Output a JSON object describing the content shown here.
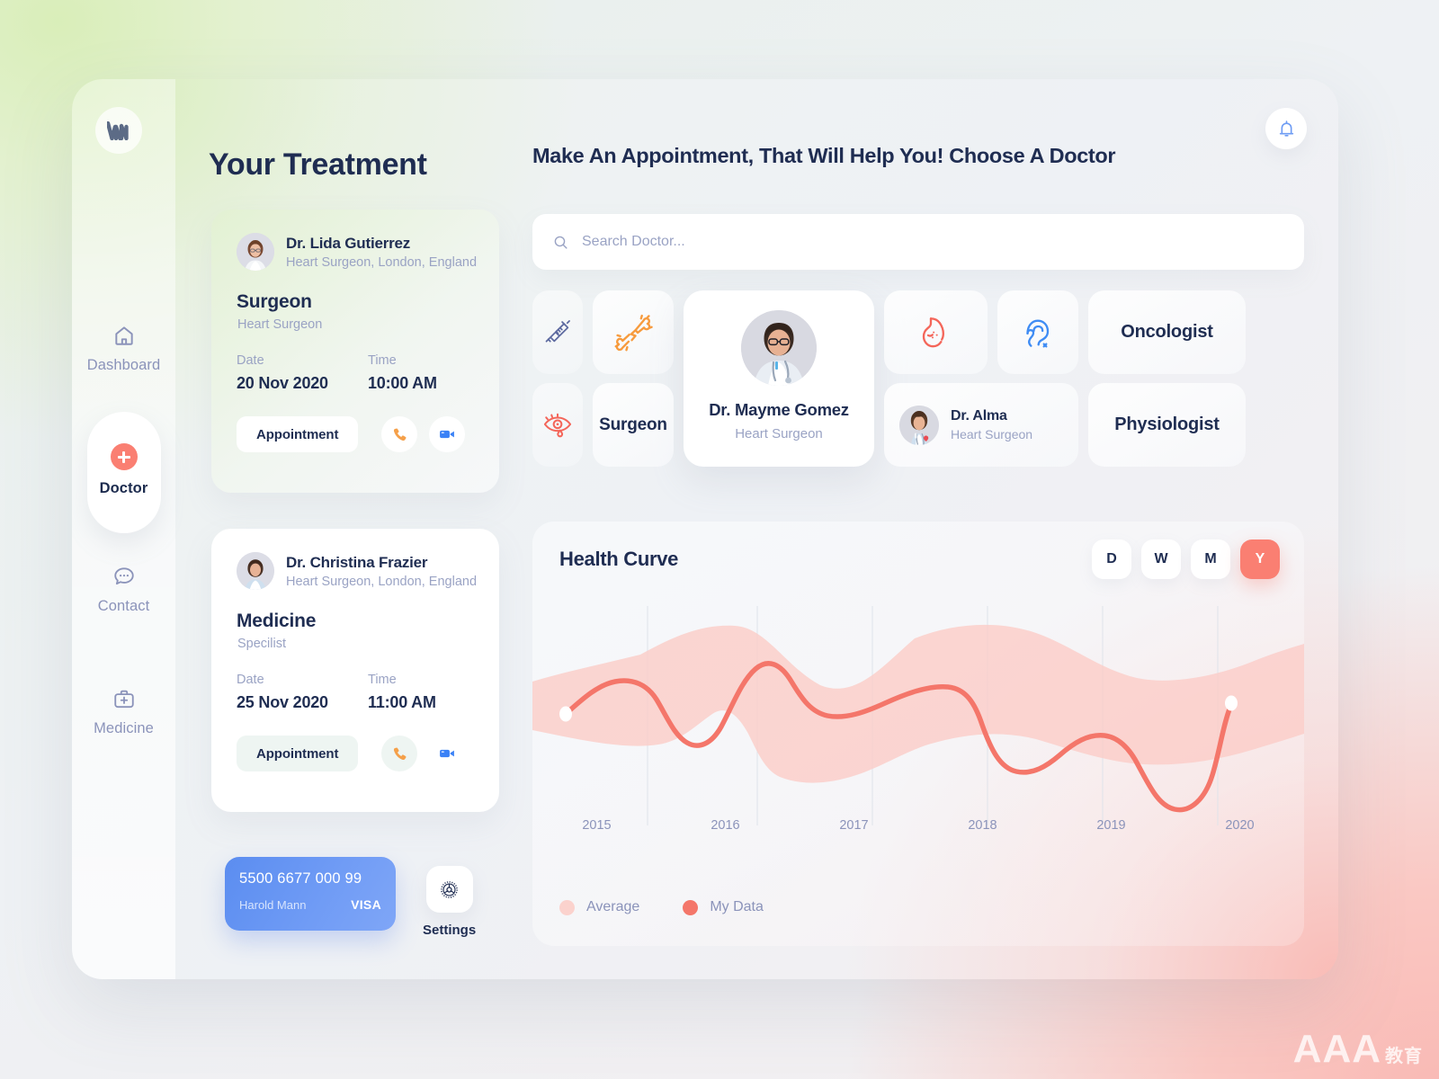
{
  "brand": {
    "logo_name": "wm-monogram"
  },
  "sidebar": {
    "items": [
      {
        "label": "Dashboard",
        "icon": "home-icon",
        "active": false
      },
      {
        "label": "Doctor",
        "icon": "plus-circle-icon",
        "active": true
      },
      {
        "label": "Contact",
        "icon": "chat-bubble-icon",
        "active": false
      },
      {
        "label": "Medicine",
        "icon": "medical-bag-icon",
        "active": false
      }
    ]
  },
  "treatment": {
    "title": "Your Treatment",
    "cards": [
      {
        "doctor_name": "Dr. Lida Gutierrez",
        "doctor_sub": "Heart Surgeon, London, England",
        "specialty": "Surgeon",
        "specialty_sub": "Heart Surgeon",
        "date_label": "Date",
        "date_value": "20 Nov 2020",
        "time_label": "Time",
        "time_value": "10:00 AM",
        "button": "Appointment",
        "phone_icon": "phone-icon",
        "video_icon": "video-camera-icon"
      },
      {
        "doctor_name": "Dr. Christina Frazier",
        "doctor_sub": "Heart Surgeon, London, England",
        "specialty": "Medicine",
        "specialty_sub": "Specilist",
        "date_label": "Date",
        "date_value": "25 Nov 2020",
        "time_label": "Time",
        "time_value": "11:00 AM",
        "button": "Appointment",
        "phone_icon": "phone-icon",
        "video_icon": "video-camera-icon"
      }
    ]
  },
  "payment": {
    "card_number": "5500 6677 000 99",
    "card_holder": "Harold Mann",
    "card_brand": "VISA",
    "settings_label": "Settings",
    "settings_icon": "gear-icon"
  },
  "main": {
    "title": "Make An Appointment, That Will Help You! Choose A Doctor",
    "bell_icon": "bell-icon",
    "search": {
      "placeholder": "Search Doctor...",
      "value": "",
      "icon": "search-icon"
    }
  },
  "categories": [
    {
      "type": "icon",
      "icon": "syringe-icon",
      "label": ""
    },
    {
      "type": "icon",
      "icon": "broken-bone-icon",
      "label": ""
    },
    {
      "type": "icon",
      "icon": "stomach-icon",
      "label": ""
    },
    {
      "type": "icon",
      "icon": "ear-icon",
      "label": ""
    },
    {
      "type": "text",
      "label": "Oncologist"
    },
    {
      "type": "icon",
      "icon": "eye-icon",
      "label": ""
    },
    {
      "type": "text",
      "label": "Surgeon"
    },
    {
      "type": "text",
      "label": "Physiologist"
    }
  ],
  "featured_doctor": {
    "name": "Dr. Mayme Gomez",
    "sub": "Heart Surgeon"
  },
  "mini_doctor": {
    "name": "Dr. Alma",
    "sub": "Heart Surgeon"
  },
  "health_curve": {
    "title": "Health Curve",
    "ranges": [
      {
        "label": "D",
        "active": false
      },
      {
        "label": "W",
        "active": false
      },
      {
        "label": "M",
        "active": false
      },
      {
        "label": "Y",
        "active": true
      }
    ]
  },
  "chart_data": {
    "type": "area",
    "title": "Health Curve",
    "xlabel": "",
    "ylabel": "",
    "categories": [
      "2015",
      "2016",
      "2017",
      "2018",
      "2019",
      "2020"
    ],
    "x": [
      2015,
      2016,
      2017,
      2018,
      2019,
      2020
    ],
    "ylim": [
      0,
      100
    ],
    "grid": true,
    "legend_position": "bottom-left",
    "series": [
      {
        "name": "Average",
        "type": "band",
        "color": "#fbd2cd",
        "upper": [
          62,
          66,
          84,
          72,
          88,
          90,
          72,
          70,
          78,
          82,
          68,
          64,
          70
        ],
        "lower": [
          42,
          40,
          36,
          20,
          12,
          34,
          38,
          36,
          30,
          22,
          24,
          34,
          40
        ]
      },
      {
        "name": "My Data",
        "type": "line",
        "color": "#f4766a",
        "values": [
          44,
          58,
          57,
          30,
          28,
          72,
          70,
          56,
          55,
          64,
          66,
          30,
          24,
          40,
          42,
          10,
          12,
          62
        ],
        "markers": [
          {
            "x": 2014.6,
            "y": 44,
            "style": "white-dot"
          },
          {
            "x": 2020.6,
            "y": 62,
            "style": "white-dot"
          }
        ]
      }
    ],
    "legend": [
      {
        "label": "Average",
        "color": "#fbd2cd"
      },
      {
        "label": "My Data",
        "color": "#f4766a"
      }
    ]
  },
  "watermark": {
    "text": "AAA",
    "sub": "教育"
  }
}
